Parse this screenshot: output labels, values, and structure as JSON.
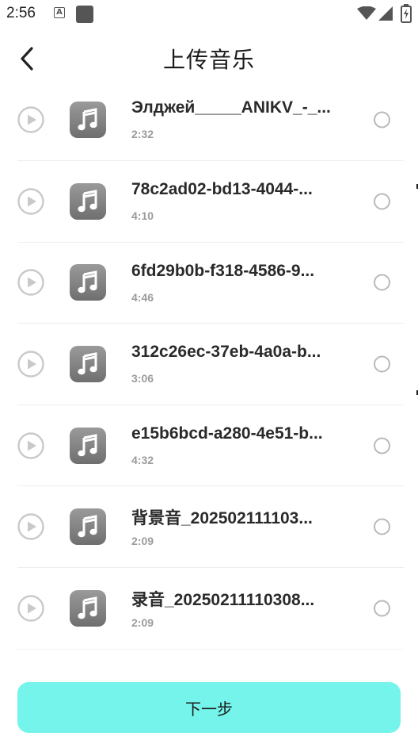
{
  "status_bar": {
    "time": "2:56",
    "a_badge": "A",
    "icons": [
      "notification-a-icon",
      "app-square-icon",
      "wifi-icon",
      "signal-icon",
      "battery-icon"
    ]
  },
  "header": {
    "title": "上传音乐",
    "back_icon": "chevron-left-icon"
  },
  "songs": [
    {
      "title": "Элджей_____ANIKV_-_...",
      "duration": "2:32"
    },
    {
      "title": "78c2ad02-bd13-4044-...",
      "duration": "4:10"
    },
    {
      "title": "6fd29b0b-f318-4586-9...",
      "duration": "4:46"
    },
    {
      "title": "312c26ec-37eb-4a0a-b...",
      "duration": "3:06"
    },
    {
      "title": "e15b6bcd-a280-4e51-b...",
      "duration": "4:32"
    },
    {
      "title": "背景音_202502111103...",
      "duration": "2:09"
    },
    {
      "title": "录音_20250211110308...",
      "duration": "2:09"
    }
  ],
  "footer": {
    "next_label": "下一步"
  },
  "colors": {
    "accent": "#74f4ea",
    "tile": "#7f7f7f",
    "duration": "#9b9b9b",
    "radio": "#b9b9b9"
  }
}
